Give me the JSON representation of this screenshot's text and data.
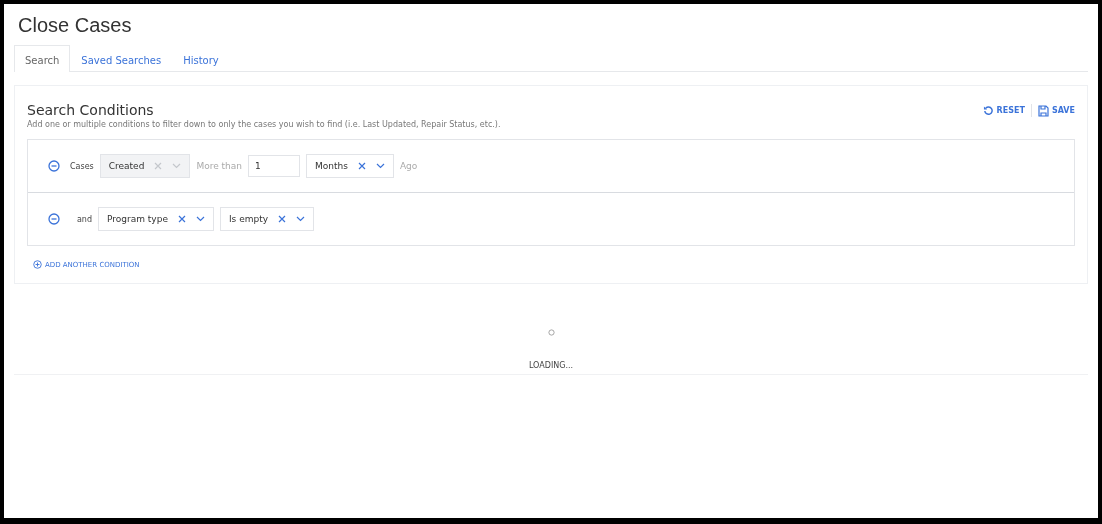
{
  "title": "Close Cases",
  "tabs": [
    {
      "label": "Search",
      "selected": true
    },
    {
      "label": "Saved Searches",
      "selected": false
    },
    {
      "label": "History",
      "selected": false
    }
  ],
  "panel": {
    "title": "Search Conditions",
    "description": "Add one or multiple conditions to filter down to only the cases you wish to find (i.e. Last Updated, Repair Status, etc.).",
    "actions": [
      {
        "kind": "reset",
        "label": "RESET"
      },
      {
        "kind": "save",
        "label": "SAVE"
      }
    ]
  },
  "conditions": [
    {
      "conjunction": "Cases",
      "parts": [
        {
          "kind": "select",
          "value": "Created",
          "disabled": true
        },
        {
          "kind": "text",
          "value": "More than"
        },
        {
          "kind": "input",
          "value": "1"
        },
        {
          "kind": "select",
          "value": "Months",
          "disabled": false
        },
        {
          "kind": "text",
          "value": "Ago"
        }
      ]
    },
    {
      "conjunction": "and",
      "parts": [
        {
          "kind": "select",
          "value": "Program type",
          "disabled": false
        },
        {
          "kind": "select",
          "value": "Is empty",
          "disabled": false
        }
      ]
    }
  ],
  "add_condition": "ADD ANOTHER CONDITION",
  "loading": "LOADING..."
}
